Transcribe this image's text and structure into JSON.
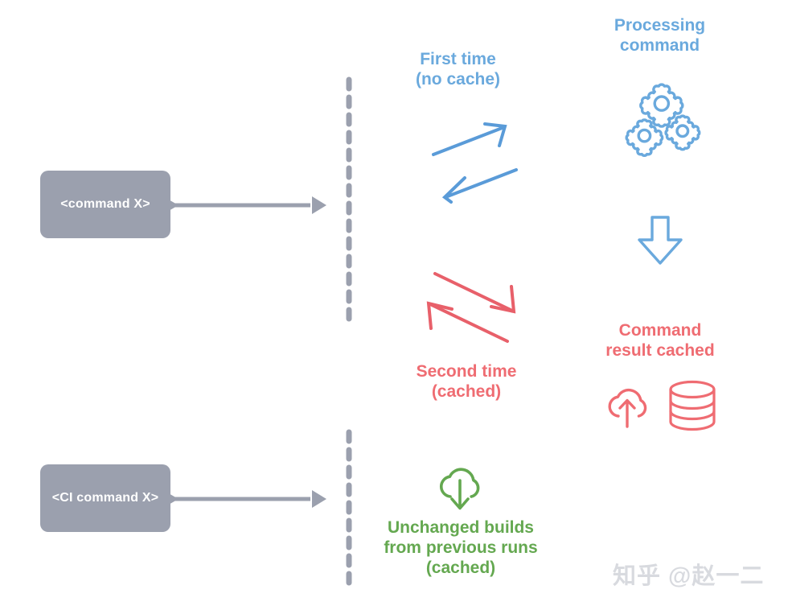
{
  "diagram": {
    "title_hidden": "Command caching flow diagram",
    "palette": {
      "box_gray": "#9ba0ae",
      "line_gray": "#9ba0ae",
      "blue": "#6aa9dd",
      "red": "#ef6c72",
      "green": "#64a850",
      "watermark_gray": "#d8dadf",
      "background": "#ffffff"
    },
    "boxes": [
      {
        "id": "command-x",
        "label": "<command X>"
      },
      {
        "id": "ci-command-x",
        "label": "<CI command X>"
      }
    ],
    "labels": {
      "first_time": "First time\n(no cache)",
      "processing_command": "Processing\ncommand",
      "second_time": "Second time\n(cached)",
      "command_result_cached": "Command\nresult cached",
      "unchanged_builds": "Unchanged builds\nfrom previous runs\n(cached)"
    },
    "icons": [
      {
        "name": "gears-icon",
        "color": "#6aa9dd",
        "meaning": "processing command"
      },
      {
        "name": "arrow-down-block-icon",
        "color": "#6aa9dd",
        "meaning": "leads to"
      },
      {
        "name": "cloud-upload-icon",
        "color": "#ef6c72",
        "meaning": "result uploaded to cache"
      },
      {
        "name": "database-icon",
        "color": "#ef6c72",
        "meaning": "cache storage"
      },
      {
        "name": "cloud-download-icon",
        "color": "#64a850",
        "meaning": "cached build downloaded"
      }
    ],
    "arrows": [
      {
        "name": "first-time-request-arrow",
        "color": "#6aa9dd",
        "direction": "up-right"
      },
      {
        "name": "first-time-response-arrow",
        "color": "#6aa9dd",
        "direction": "down-left"
      },
      {
        "name": "second-time-request-arrow",
        "color": "#ef6c72",
        "direction": "down-right"
      },
      {
        "name": "second-time-response-arrow",
        "color": "#ef6c72",
        "direction": "up-left"
      },
      {
        "name": "command-x-flow-arrow",
        "color": "#9ba0ae",
        "direction": "right"
      },
      {
        "name": "ci-command-x-flow-arrow",
        "color": "#9ba0ae",
        "direction": "right"
      }
    ],
    "dividers": [
      {
        "name": "divider-top",
        "style": "dashed-vertical"
      },
      {
        "name": "divider-bottom",
        "style": "dashed-vertical"
      }
    ],
    "watermark": "知乎 @赵一二"
  }
}
